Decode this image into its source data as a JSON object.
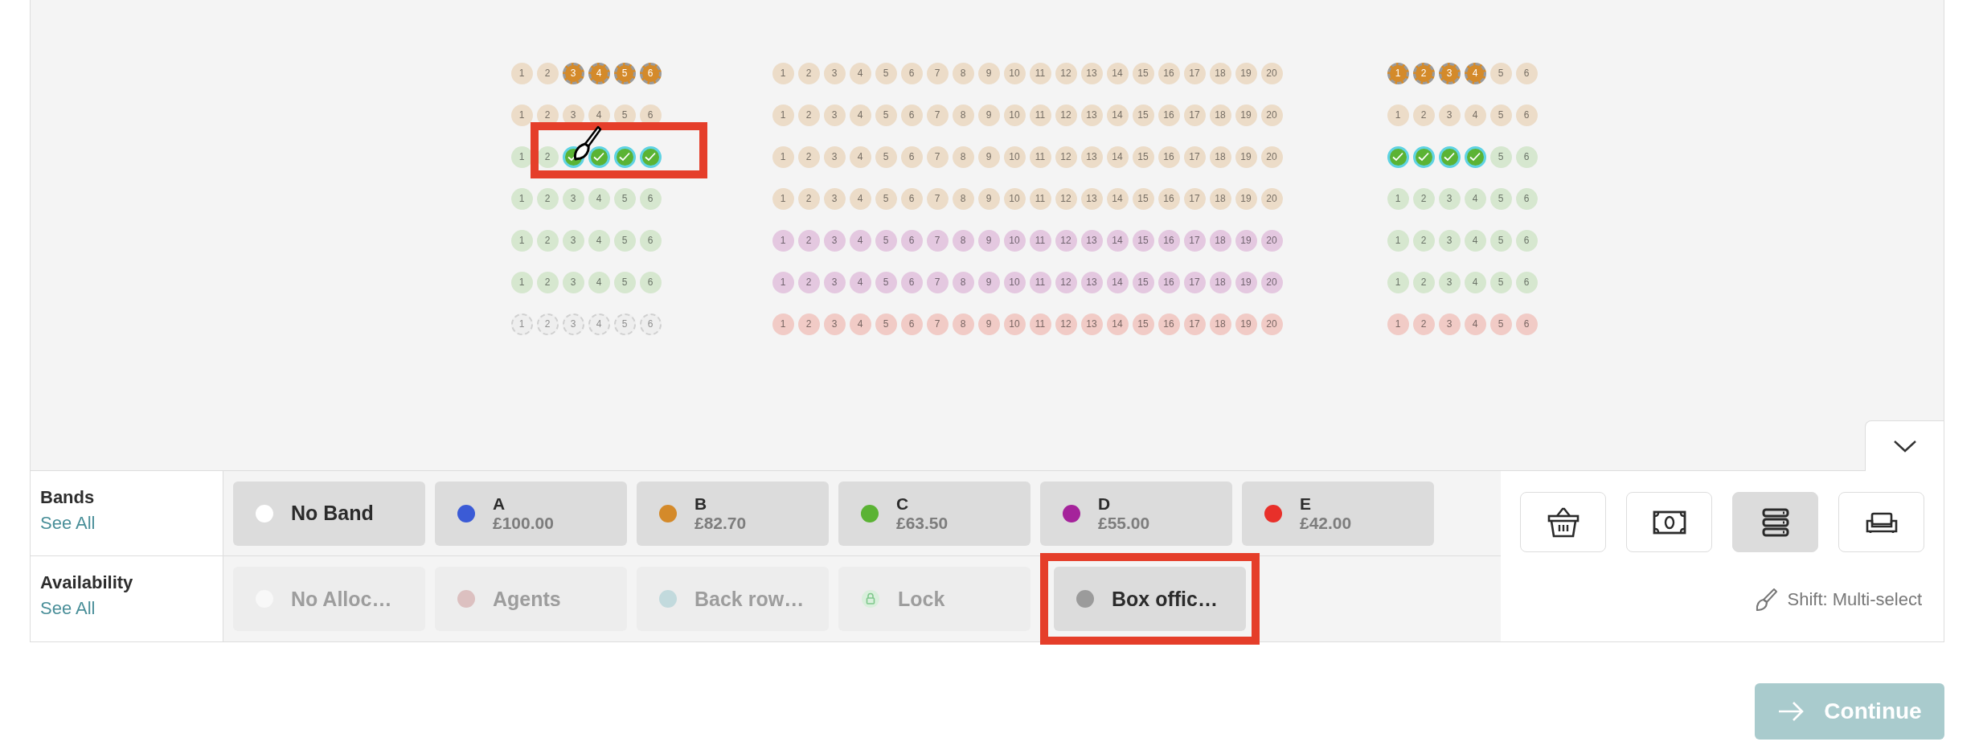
{
  "seat_map": {
    "sections": [
      {
        "rows": [
          {
            "color": "#ecdcc8",
            "seats": [
              {
                "label": "1",
                "kind": "available"
              },
              {
                "label": "2",
                "kind": "available"
              },
              {
                "label": "3",
                "kind": "held",
                "color": "#d48a2a"
              },
              {
                "label": "4",
                "kind": "held",
                "color": "#d48a2a"
              },
              {
                "label": "5",
                "kind": "held",
                "color": "#d48a2a"
              },
              {
                "label": "6",
                "kind": "held",
                "color": "#d48a2a"
              }
            ]
          },
          {
            "color": "#ecdcc8",
            "seats": [
              {
                "label": "1",
                "kind": "available"
              },
              {
                "label": "2",
                "kind": "available"
              },
              {
                "label": "3",
                "kind": "available"
              },
              {
                "label": "4",
                "kind": "available"
              },
              {
                "label": "5",
                "kind": "available"
              },
              {
                "label": "6",
                "kind": "available"
              }
            ]
          },
          {
            "color": "#d6e7cf",
            "seats": [
              {
                "label": "1",
                "kind": "available"
              },
              {
                "label": "2",
                "kind": "available"
              },
              {
                "kind": "selected",
                "color": "#5bb334"
              },
              {
                "kind": "selected",
                "color": "#5bb334"
              },
              {
                "kind": "selected",
                "color": "#5bb334"
              },
              {
                "kind": "selected",
                "color": "#5bb334"
              }
            ]
          },
          {
            "color": "#d6e7cf",
            "seats": [
              {
                "label": "1",
                "kind": "available"
              },
              {
                "label": "2",
                "kind": "available"
              },
              {
                "label": "3",
                "kind": "available"
              },
              {
                "label": "4",
                "kind": "available"
              },
              {
                "label": "5",
                "kind": "available"
              },
              {
                "label": "6",
                "kind": "available"
              }
            ]
          },
          {
            "color": "#d6e7cf",
            "seats": [
              {
                "label": "1",
                "kind": "available"
              },
              {
                "label": "2",
                "kind": "available"
              },
              {
                "label": "3",
                "kind": "available"
              },
              {
                "label": "4",
                "kind": "available"
              },
              {
                "label": "5",
                "kind": "available"
              },
              {
                "label": "6",
                "kind": "available"
              }
            ]
          },
          {
            "color": "#d6e7cf",
            "seats": [
              {
                "label": "1",
                "kind": "available"
              },
              {
                "label": "2",
                "kind": "available"
              },
              {
                "label": "3",
                "kind": "available"
              },
              {
                "label": "4",
                "kind": "available"
              },
              {
                "label": "5",
                "kind": "available"
              },
              {
                "label": "6",
                "kind": "available"
              }
            ]
          },
          {
            "seats": [
              {
                "label": "1",
                "kind": "unallocated"
              },
              {
                "label": "2",
                "kind": "unallocated"
              },
              {
                "label": "3",
                "kind": "unallocated"
              },
              {
                "label": "4",
                "kind": "unallocated"
              },
              {
                "label": "5",
                "kind": "unallocated"
              },
              {
                "label": "6",
                "kind": "unallocated"
              }
            ]
          }
        ]
      },
      {
        "rows": [
          {
            "color": "#ecdcc8",
            "seats": [
              {
                "label": "1",
                "kind": "available"
              },
              {
                "label": "2",
                "kind": "available"
              },
              {
                "label": "3",
                "kind": "available"
              },
              {
                "label": "4",
                "kind": "available"
              },
              {
                "label": "5",
                "kind": "available"
              },
              {
                "label": "6",
                "kind": "available"
              },
              {
                "label": "7",
                "kind": "available"
              },
              {
                "label": "8",
                "kind": "available"
              },
              {
                "label": "9",
                "kind": "available"
              },
              {
                "label": "10",
                "kind": "available"
              },
              {
                "label": "11",
                "kind": "available"
              },
              {
                "label": "12",
                "kind": "available"
              },
              {
                "label": "13",
                "kind": "available"
              },
              {
                "label": "14",
                "kind": "available"
              },
              {
                "label": "15",
                "kind": "available"
              },
              {
                "label": "16",
                "kind": "available"
              },
              {
                "label": "17",
                "kind": "available"
              },
              {
                "label": "18",
                "kind": "available"
              },
              {
                "label": "19",
                "kind": "available"
              },
              {
                "label": "20",
                "kind": "available"
              }
            ]
          },
          {
            "color": "#ecdcc8",
            "seats": [
              {
                "label": "1",
                "kind": "available"
              },
              {
                "label": "2",
                "kind": "available"
              },
              {
                "label": "3",
                "kind": "available"
              },
              {
                "label": "4",
                "kind": "available"
              },
              {
                "label": "5",
                "kind": "available"
              },
              {
                "label": "6",
                "kind": "available"
              },
              {
                "label": "7",
                "kind": "available"
              },
              {
                "label": "8",
                "kind": "available"
              },
              {
                "label": "9",
                "kind": "available"
              },
              {
                "label": "10",
                "kind": "available"
              },
              {
                "label": "11",
                "kind": "available"
              },
              {
                "label": "12",
                "kind": "available"
              },
              {
                "label": "13",
                "kind": "available"
              },
              {
                "label": "14",
                "kind": "available"
              },
              {
                "label": "15",
                "kind": "available"
              },
              {
                "label": "16",
                "kind": "available"
              },
              {
                "label": "17",
                "kind": "available"
              },
              {
                "label": "18",
                "kind": "available"
              },
              {
                "label": "19",
                "kind": "available"
              },
              {
                "label": "20",
                "kind": "available"
              }
            ]
          },
          {
            "color": "#ecdcc8",
            "seats": [
              {
                "label": "1",
                "kind": "available"
              },
              {
                "label": "2",
                "kind": "available"
              },
              {
                "label": "3",
                "kind": "available"
              },
              {
                "label": "4",
                "kind": "available"
              },
              {
                "label": "5",
                "kind": "available"
              },
              {
                "label": "6",
                "kind": "available"
              },
              {
                "label": "7",
                "kind": "available"
              },
              {
                "label": "8",
                "kind": "available"
              },
              {
                "label": "9",
                "kind": "available"
              },
              {
                "label": "10",
                "kind": "available"
              },
              {
                "label": "11",
                "kind": "available"
              },
              {
                "label": "12",
                "kind": "available"
              },
              {
                "label": "13",
                "kind": "available"
              },
              {
                "label": "14",
                "kind": "available"
              },
              {
                "label": "15",
                "kind": "available"
              },
              {
                "label": "16",
                "kind": "available"
              },
              {
                "label": "17",
                "kind": "available"
              },
              {
                "label": "18",
                "kind": "available"
              },
              {
                "label": "19",
                "kind": "available"
              },
              {
                "label": "20",
                "kind": "available"
              }
            ]
          },
          {
            "color": "#ecdcc8",
            "seats": [
              {
                "label": "1",
                "kind": "available"
              },
              {
                "label": "2",
                "kind": "available"
              },
              {
                "label": "3",
                "kind": "available"
              },
              {
                "label": "4",
                "kind": "available"
              },
              {
                "label": "5",
                "kind": "available"
              },
              {
                "label": "6",
                "kind": "available"
              },
              {
                "label": "7",
                "kind": "available"
              },
              {
                "label": "8",
                "kind": "available"
              },
              {
                "label": "9",
                "kind": "available"
              },
              {
                "label": "10",
                "kind": "available"
              },
              {
                "label": "11",
                "kind": "available"
              },
              {
                "label": "12",
                "kind": "available"
              },
              {
                "label": "13",
                "kind": "available"
              },
              {
                "label": "14",
                "kind": "available"
              },
              {
                "label": "15",
                "kind": "available"
              },
              {
                "label": "16",
                "kind": "available"
              },
              {
                "label": "17",
                "kind": "available"
              },
              {
                "label": "18",
                "kind": "available"
              },
              {
                "label": "19",
                "kind": "available"
              },
              {
                "label": "20",
                "kind": "available"
              }
            ]
          },
          {
            "color": "#e4c8e0",
            "seats": [
              {
                "label": "1",
                "kind": "available"
              },
              {
                "label": "2",
                "kind": "available"
              },
              {
                "label": "3",
                "kind": "available"
              },
              {
                "label": "4",
                "kind": "available"
              },
              {
                "label": "5",
                "kind": "available"
              },
              {
                "label": "6",
                "kind": "available"
              },
              {
                "label": "7",
                "kind": "available"
              },
              {
                "label": "8",
                "kind": "available"
              },
              {
                "label": "9",
                "kind": "available"
              },
              {
                "label": "10",
                "kind": "available"
              },
              {
                "label": "11",
                "kind": "available"
              },
              {
                "label": "12",
                "kind": "available"
              },
              {
                "label": "13",
                "kind": "available"
              },
              {
                "label": "14",
                "kind": "available"
              },
              {
                "label": "15",
                "kind": "available"
              },
              {
                "label": "16",
                "kind": "available"
              },
              {
                "label": "17",
                "kind": "available"
              },
              {
                "label": "18",
                "kind": "available"
              },
              {
                "label": "19",
                "kind": "available"
              },
              {
                "label": "20",
                "kind": "available"
              }
            ]
          },
          {
            "color": "#e4c8e0",
            "seats": [
              {
                "label": "1",
                "kind": "available"
              },
              {
                "label": "2",
                "kind": "available"
              },
              {
                "label": "3",
                "kind": "available"
              },
              {
                "label": "4",
                "kind": "available"
              },
              {
                "label": "5",
                "kind": "available"
              },
              {
                "label": "6",
                "kind": "available"
              },
              {
                "label": "7",
                "kind": "available"
              },
              {
                "label": "8",
                "kind": "available"
              },
              {
                "label": "9",
                "kind": "available"
              },
              {
                "label": "10",
                "kind": "available"
              },
              {
                "label": "11",
                "kind": "available"
              },
              {
                "label": "12",
                "kind": "available"
              },
              {
                "label": "13",
                "kind": "available"
              },
              {
                "label": "14",
                "kind": "available"
              },
              {
                "label": "15",
                "kind": "available"
              },
              {
                "label": "16",
                "kind": "available"
              },
              {
                "label": "17",
                "kind": "available"
              },
              {
                "label": "18",
                "kind": "available"
              },
              {
                "label": "19",
                "kind": "available"
              },
              {
                "label": "20",
                "kind": "available"
              }
            ]
          },
          {
            "color": "#f1cbc6",
            "seats": [
              {
                "label": "1",
                "kind": "available"
              },
              {
                "label": "2",
                "kind": "available"
              },
              {
                "label": "3",
                "kind": "available"
              },
              {
                "label": "4",
                "kind": "available"
              },
              {
                "label": "5",
                "kind": "available"
              },
              {
                "label": "6",
                "kind": "available"
              },
              {
                "label": "7",
                "kind": "available"
              },
              {
                "label": "8",
                "kind": "available"
              },
              {
                "label": "9",
                "kind": "available"
              },
              {
                "label": "10",
                "kind": "available"
              },
              {
                "label": "11",
                "kind": "available"
              },
              {
                "label": "12",
                "kind": "available"
              },
              {
                "label": "13",
                "kind": "available"
              },
              {
                "label": "14",
                "kind": "available"
              },
              {
                "label": "15",
                "kind": "available"
              },
              {
                "label": "16",
                "kind": "available"
              },
              {
                "label": "17",
                "kind": "available"
              },
              {
                "label": "18",
                "kind": "available"
              },
              {
                "label": "19",
                "kind": "available"
              },
              {
                "label": "20",
                "kind": "available"
              }
            ]
          }
        ]
      },
      {
        "rows": [
          {
            "color": "#ecdcc8",
            "seats": [
              {
                "label": "1",
                "kind": "held",
                "color": "#d48a2a"
              },
              {
                "label": "2",
                "kind": "held",
                "color": "#d48a2a"
              },
              {
                "label": "3",
                "kind": "held",
                "color": "#d48a2a"
              },
              {
                "label": "4",
                "kind": "held",
                "color": "#d48a2a"
              },
              {
                "label": "5",
                "kind": "available"
              },
              {
                "label": "6",
                "kind": "available"
              }
            ]
          },
          {
            "color": "#ecdcc8",
            "seats": [
              {
                "label": "1",
                "kind": "available"
              },
              {
                "label": "2",
                "kind": "available"
              },
              {
                "label": "3",
                "kind": "available"
              },
              {
                "label": "4",
                "kind": "available"
              },
              {
                "label": "5",
                "kind": "available"
              },
              {
                "label": "6",
                "kind": "available"
              }
            ]
          },
          {
            "color": "#d6e7cf",
            "seats": [
              {
                "kind": "selected",
                "color": "#5bb334"
              },
              {
                "kind": "selected",
                "color": "#5bb334"
              },
              {
                "kind": "selected",
                "color": "#5bb334"
              },
              {
                "kind": "selected",
                "color": "#5bb334"
              },
              {
                "label": "5",
                "kind": "available"
              },
              {
                "label": "6",
                "kind": "available"
              }
            ]
          },
          {
            "color": "#d6e7cf",
            "seats": [
              {
                "label": "1",
                "kind": "available"
              },
              {
                "label": "2",
                "kind": "available"
              },
              {
                "label": "3",
                "kind": "available"
              },
              {
                "label": "4",
                "kind": "available"
              },
              {
                "label": "5",
                "kind": "available"
              },
              {
                "label": "6",
                "kind": "available"
              }
            ]
          },
          {
            "color": "#d6e7cf",
            "seats": [
              {
                "label": "1",
                "kind": "available"
              },
              {
                "label": "2",
                "kind": "available"
              },
              {
                "label": "3",
                "kind": "available"
              },
              {
                "label": "4",
                "kind": "available"
              },
              {
                "label": "5",
                "kind": "available"
              },
              {
                "label": "6",
                "kind": "available"
              }
            ]
          },
          {
            "color": "#d6e7cf",
            "seats": [
              {
                "label": "1",
                "kind": "available"
              },
              {
                "label": "2",
                "kind": "available"
              },
              {
                "label": "3",
                "kind": "available"
              },
              {
                "label": "4",
                "kind": "available"
              },
              {
                "label": "5",
                "kind": "available"
              },
              {
                "label": "6",
                "kind": "available"
              }
            ]
          },
          {
            "color": "#f1cbc6",
            "seats": [
              {
                "label": "1",
                "kind": "available"
              },
              {
                "label": "2",
                "kind": "available"
              },
              {
                "label": "3",
                "kind": "available"
              },
              {
                "label": "4",
                "kind": "available"
              },
              {
                "label": "5",
                "kind": "available"
              },
              {
                "label": "6",
                "kind": "available"
              }
            ]
          }
        ]
      }
    ]
  },
  "bands": {
    "label": "Bands",
    "see_all": "See All",
    "items": [
      {
        "name": "No Band",
        "color": "#ffffff"
      },
      {
        "name": "A",
        "price": "£100.00",
        "color": "#3b5bd6"
      },
      {
        "name": "B",
        "price": "£82.70",
        "color": "#d48a2a"
      },
      {
        "name": "C",
        "price": "£63.50",
        "color": "#5bb334"
      },
      {
        "name": "D",
        "price": "£55.00",
        "color": "#a5239b"
      },
      {
        "name": "E",
        "price": "£42.00",
        "color": "#e8302a"
      }
    ]
  },
  "availability": {
    "label": "Availability",
    "see_all": "See All",
    "items": [
      {
        "kind": "dot",
        "name": "No Alloc…",
        "color": "#f8f8f8",
        "selected": false
      },
      {
        "kind": "dot",
        "name": "Agents",
        "color": "#dcc0c0",
        "selected": false
      },
      {
        "kind": "dot",
        "name": "Back row…",
        "color": "#c2dadd",
        "selected": false
      },
      {
        "kind": "lock",
        "name": "Lock",
        "selected": false
      },
      {
        "kind": "dot",
        "name": "Box offic…",
        "color": "#9b9b9b",
        "selected": true,
        "highlighted": true
      }
    ]
  },
  "tools": {
    "buttons": [
      {
        "kind": "basket",
        "selected": false
      },
      {
        "kind": "banknote",
        "selected": false
      },
      {
        "kind": "stack",
        "selected": true
      },
      {
        "kind": "sofa",
        "selected": false
      }
    ],
    "hint": "Shift: Multi-select"
  },
  "continue_button": "Continue"
}
